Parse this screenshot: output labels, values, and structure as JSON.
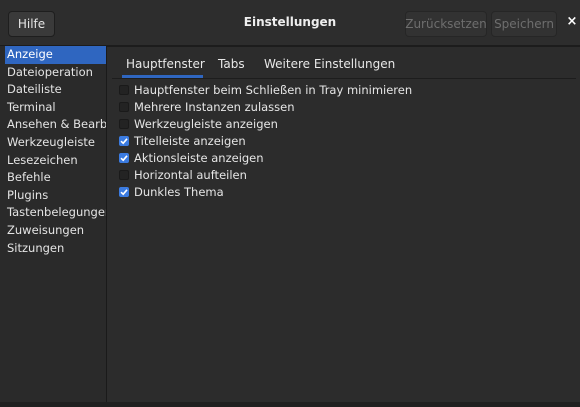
{
  "header": {
    "help_label": "Hilfe",
    "title": "Einstellungen",
    "reset_label": "Zurücksetzen",
    "save_label": "Speichern",
    "close_glyph": "×"
  },
  "sidebar": {
    "items": [
      {
        "label": "Anzeige",
        "active": true
      },
      {
        "label": "Dateioperation"
      },
      {
        "label": "Dateiliste"
      },
      {
        "label": "Terminal"
      },
      {
        "label": "Ansehen & Bearbeiten"
      },
      {
        "label": "Werkzeugleiste"
      },
      {
        "label": "Lesezeichen"
      },
      {
        "label": "Befehle"
      },
      {
        "label": "Plugins"
      },
      {
        "label": "Tastenbelegungen"
      },
      {
        "label": "Zuweisungen"
      },
      {
        "label": "Sitzungen"
      }
    ]
  },
  "tabs": [
    {
      "label": "Hauptfenster",
      "active": true
    },
    {
      "label": "Tabs"
    },
    {
      "label": "Weitere Einstellungen"
    }
  ],
  "options": [
    {
      "label": "Hauptfenster beim Schließen in Tray minimieren",
      "checked": false
    },
    {
      "label": "Mehrere Instanzen zulassen",
      "checked": false
    },
    {
      "label": "Werkzeugleiste anzeigen",
      "checked": false
    },
    {
      "label": "Titelleiste anzeigen",
      "checked": true
    },
    {
      "label": "Aktionsleiste anzeigen",
      "checked": true
    },
    {
      "label": "Horizontal aufteilen",
      "checked": false
    },
    {
      "label": "Dunkles Thema",
      "checked": true
    }
  ],
  "colors": {
    "accent": "#2f66c0",
    "checkbox_checked": "#3b7be0",
    "background": "#2a2a2a"
  }
}
